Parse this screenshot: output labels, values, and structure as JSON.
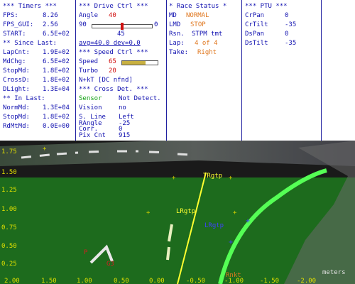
{
  "timers": {
    "header": "*** Timers ***",
    "fps_label": "FPS:",
    "fps_value": "8.26",
    "fps_gui_label": "FPS_GUI:",
    "fps_gui_value": "2.56",
    "start_label": "START:",
    "start_value": "6.5E+02",
    "since_header": "** Since Last:",
    "since": [
      {
        "label": "LapCnt:",
        "value": "1.9E+02"
      },
      {
        "label": "MdChg:",
        "value": "6.5E+02"
      },
      {
        "label": "StopMd:",
        "value": "1.8E+02"
      },
      {
        "label": "CrossD:",
        "value": "1.8E+02"
      },
      {
        "label": "DLight:",
        "value": "1.3E+04"
      }
    ],
    "in_header": "** In Last:",
    "in_last": [
      {
        "label": "NormMd:",
        "value": "1.3E+04"
      },
      {
        "label": "StopMd:",
        "value": "1.8E+02"
      },
      {
        "label": "RdMtMd:",
        "value": "0.0E+00"
      }
    ]
  },
  "drive": {
    "header": "***  Drive Ctrl  ***",
    "angle_label": "Angle",
    "angle_value": "40",
    "range_min": "90",
    "range_max": "0",
    "slider_value": "45",
    "slider_fraction": 0.5,
    "avg_dev": "avg=40.0  dev=0.0"
  },
  "speed": {
    "header": "***  Speed Ctrl  ***",
    "speed_label": "Speed",
    "speed_value": "65",
    "speed_fraction": 0.65,
    "turbo_label": "Turbo",
    "turbo_value": "20",
    "nkt_label": "N+kT [DC nfnd]"
  },
  "cross": {
    "header": "*** Cross Det. ***",
    "sensor_label": "Sensor",
    "sensor_value": "Not Detect.",
    "vision_label": "Vision",
    "vision_value": "no",
    "sline_label": "S. Line",
    "sline_value": "Left",
    "rangle_label": "RAngle",
    "rangle_value": "-25",
    "corr_label": "Corr.",
    "corr_value": "0",
    "pix_label": "Pix Cnt",
    "pix_value": "915"
  },
  "race": {
    "header": "* Race Status *",
    "md_label": "MD",
    "md_value": "NORMAL",
    "lmd_label": "LMD",
    "lmd_value": "STOP",
    "rsn_label": "Rsn.",
    "rsn_value": "STPM tmt",
    "lap_label": "Lap:",
    "lap_value": "4 of 4",
    "take_label": "Take:",
    "take_value": "Right"
  },
  "ptu": {
    "header": "*** PTU ***",
    "rows": [
      {
        "label": "CrPan",
        "value": "0"
      },
      {
        "label": "CrTilt",
        "value": "-35"
      },
      {
        "label": "DsPan",
        "value": "0"
      },
      {
        "label": "DsTilt",
        "value": "-35"
      }
    ]
  },
  "camera": {
    "y_ticks": [
      "1.75",
      "1.50",
      "1.25",
      "1.00",
      "0.75",
      "0.50",
      "0.25"
    ],
    "x_ticks": [
      "2.00",
      "1.50",
      "1.00",
      "0.50",
      "0.00",
      "-0.50",
      "-1.00",
      "-1.50",
      "-2.00"
    ],
    "units": "meters",
    "labels": {
      "tr_gtp": "TRgtp",
      "l_rgtp": "LRgtp",
      "lr_gtp": "LRgtp",
      "rnkt": "Rnkt",
      "p_label": "P",
      "g3_label": "G3"
    }
  }
}
